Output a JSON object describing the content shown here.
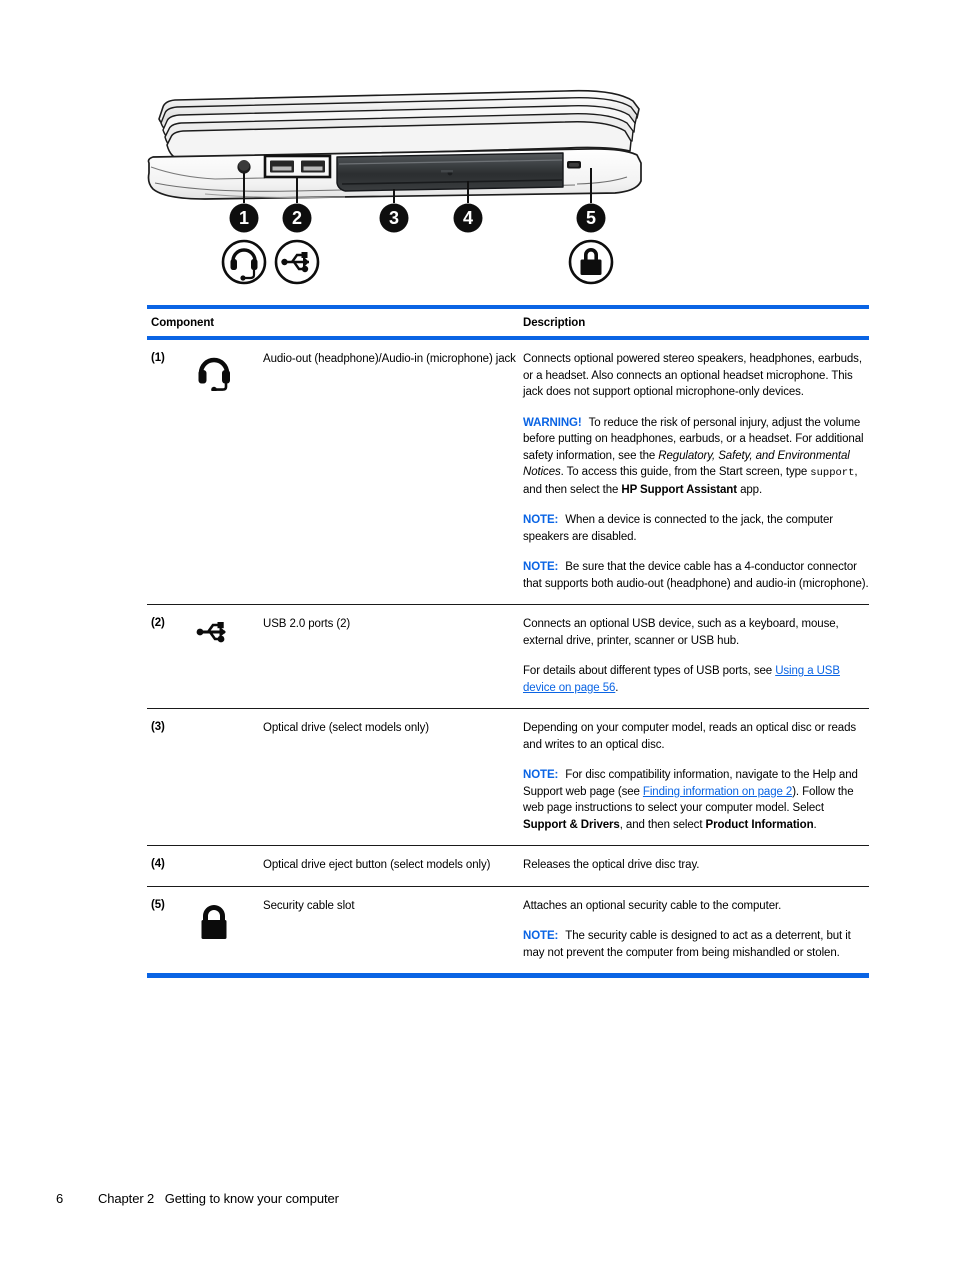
{
  "illustration": {
    "alt_name": "laptop-left-side-view",
    "callouts": [
      "1",
      "2",
      "3",
      "4",
      "5"
    ],
    "symbol_icons": [
      "headset-icon",
      "usb-icon",
      "lock-icon"
    ]
  },
  "table": {
    "header": {
      "component": "Component",
      "description": "Description"
    },
    "accent_color": "#0a64e4",
    "rows": [
      {
        "num": "(1)",
        "icon": "headset-icon",
        "component": "Audio-out (headphone)/Audio-in (microphone) jack",
        "desc_main": "Connects optional powered stereo speakers, headphones, earbuds, or a headset. Also connects an optional headset microphone. This jack does not support optional microphone-only devices.",
        "warning_label": "WARNING!",
        "warning_p1": "To reduce the risk of personal injury, adjust the volume before putting on headphones, earbuds, or a headset. For additional safety information, see the ",
        "warning_italic": "Regulatory, Safety, and Environmental Notices",
        "warning_p2": ". To access this guide, from the Start screen, type ",
        "warning_mono": "support",
        "warning_p3": ", and then select the ",
        "warning_bold": "HP Support Assistant",
        "warning_p4": " app.",
        "note1_label": "NOTE:",
        "note1_text": "When a device is connected to the jack, the computer speakers are disabled.",
        "note2_label": "NOTE:",
        "note2_text": "Be sure that the device cable has a 4-conductor connector that supports both audio-out (headphone) and audio-in (microphone)."
      },
      {
        "num": "(2)",
        "icon": "usb-icon",
        "component": "USB 2.0 ports (2)",
        "desc_main": "Connects an optional USB device, such as a keyboard, mouse, external drive, printer, scanner or USB hub.",
        "detail_pre": "For details about different types of USB ports, see ",
        "detail_link": "Using a USB device on page 56",
        "detail_post": "."
      },
      {
        "num": "(3)",
        "icon": "none",
        "component": "Optical drive (select models only)",
        "desc_main": "Depending on your computer model, reads an optical disc or reads and writes to an optical disc.",
        "note_label": "NOTE:",
        "note_pre": "For disc compatibility information, navigate to the Help and Support web page (see ",
        "note_link": "Finding information on page 2",
        "note_mid": "). Follow the web page instructions to select your computer model. Select ",
        "note_bold1": "Support & Drivers",
        "note_mid2": ", and then select ",
        "note_bold2": "Product Information",
        "note_post": "."
      },
      {
        "num": "(4)",
        "icon": "none",
        "component": "Optical drive eject button (select models only)",
        "desc_main": "Releases the optical drive disc tray."
      },
      {
        "num": "(5)",
        "icon": "lock-icon",
        "component": "Security cable slot",
        "desc_main": "Attaches an optional security cable to the computer.",
        "note_label": "NOTE:",
        "note_text": "The security cable is designed to act as a deterrent, but it may not prevent the computer from being mishandled or stolen."
      }
    ]
  },
  "footer": {
    "page_number": "6",
    "chapter": "Chapter 2   Getting to know your computer"
  }
}
